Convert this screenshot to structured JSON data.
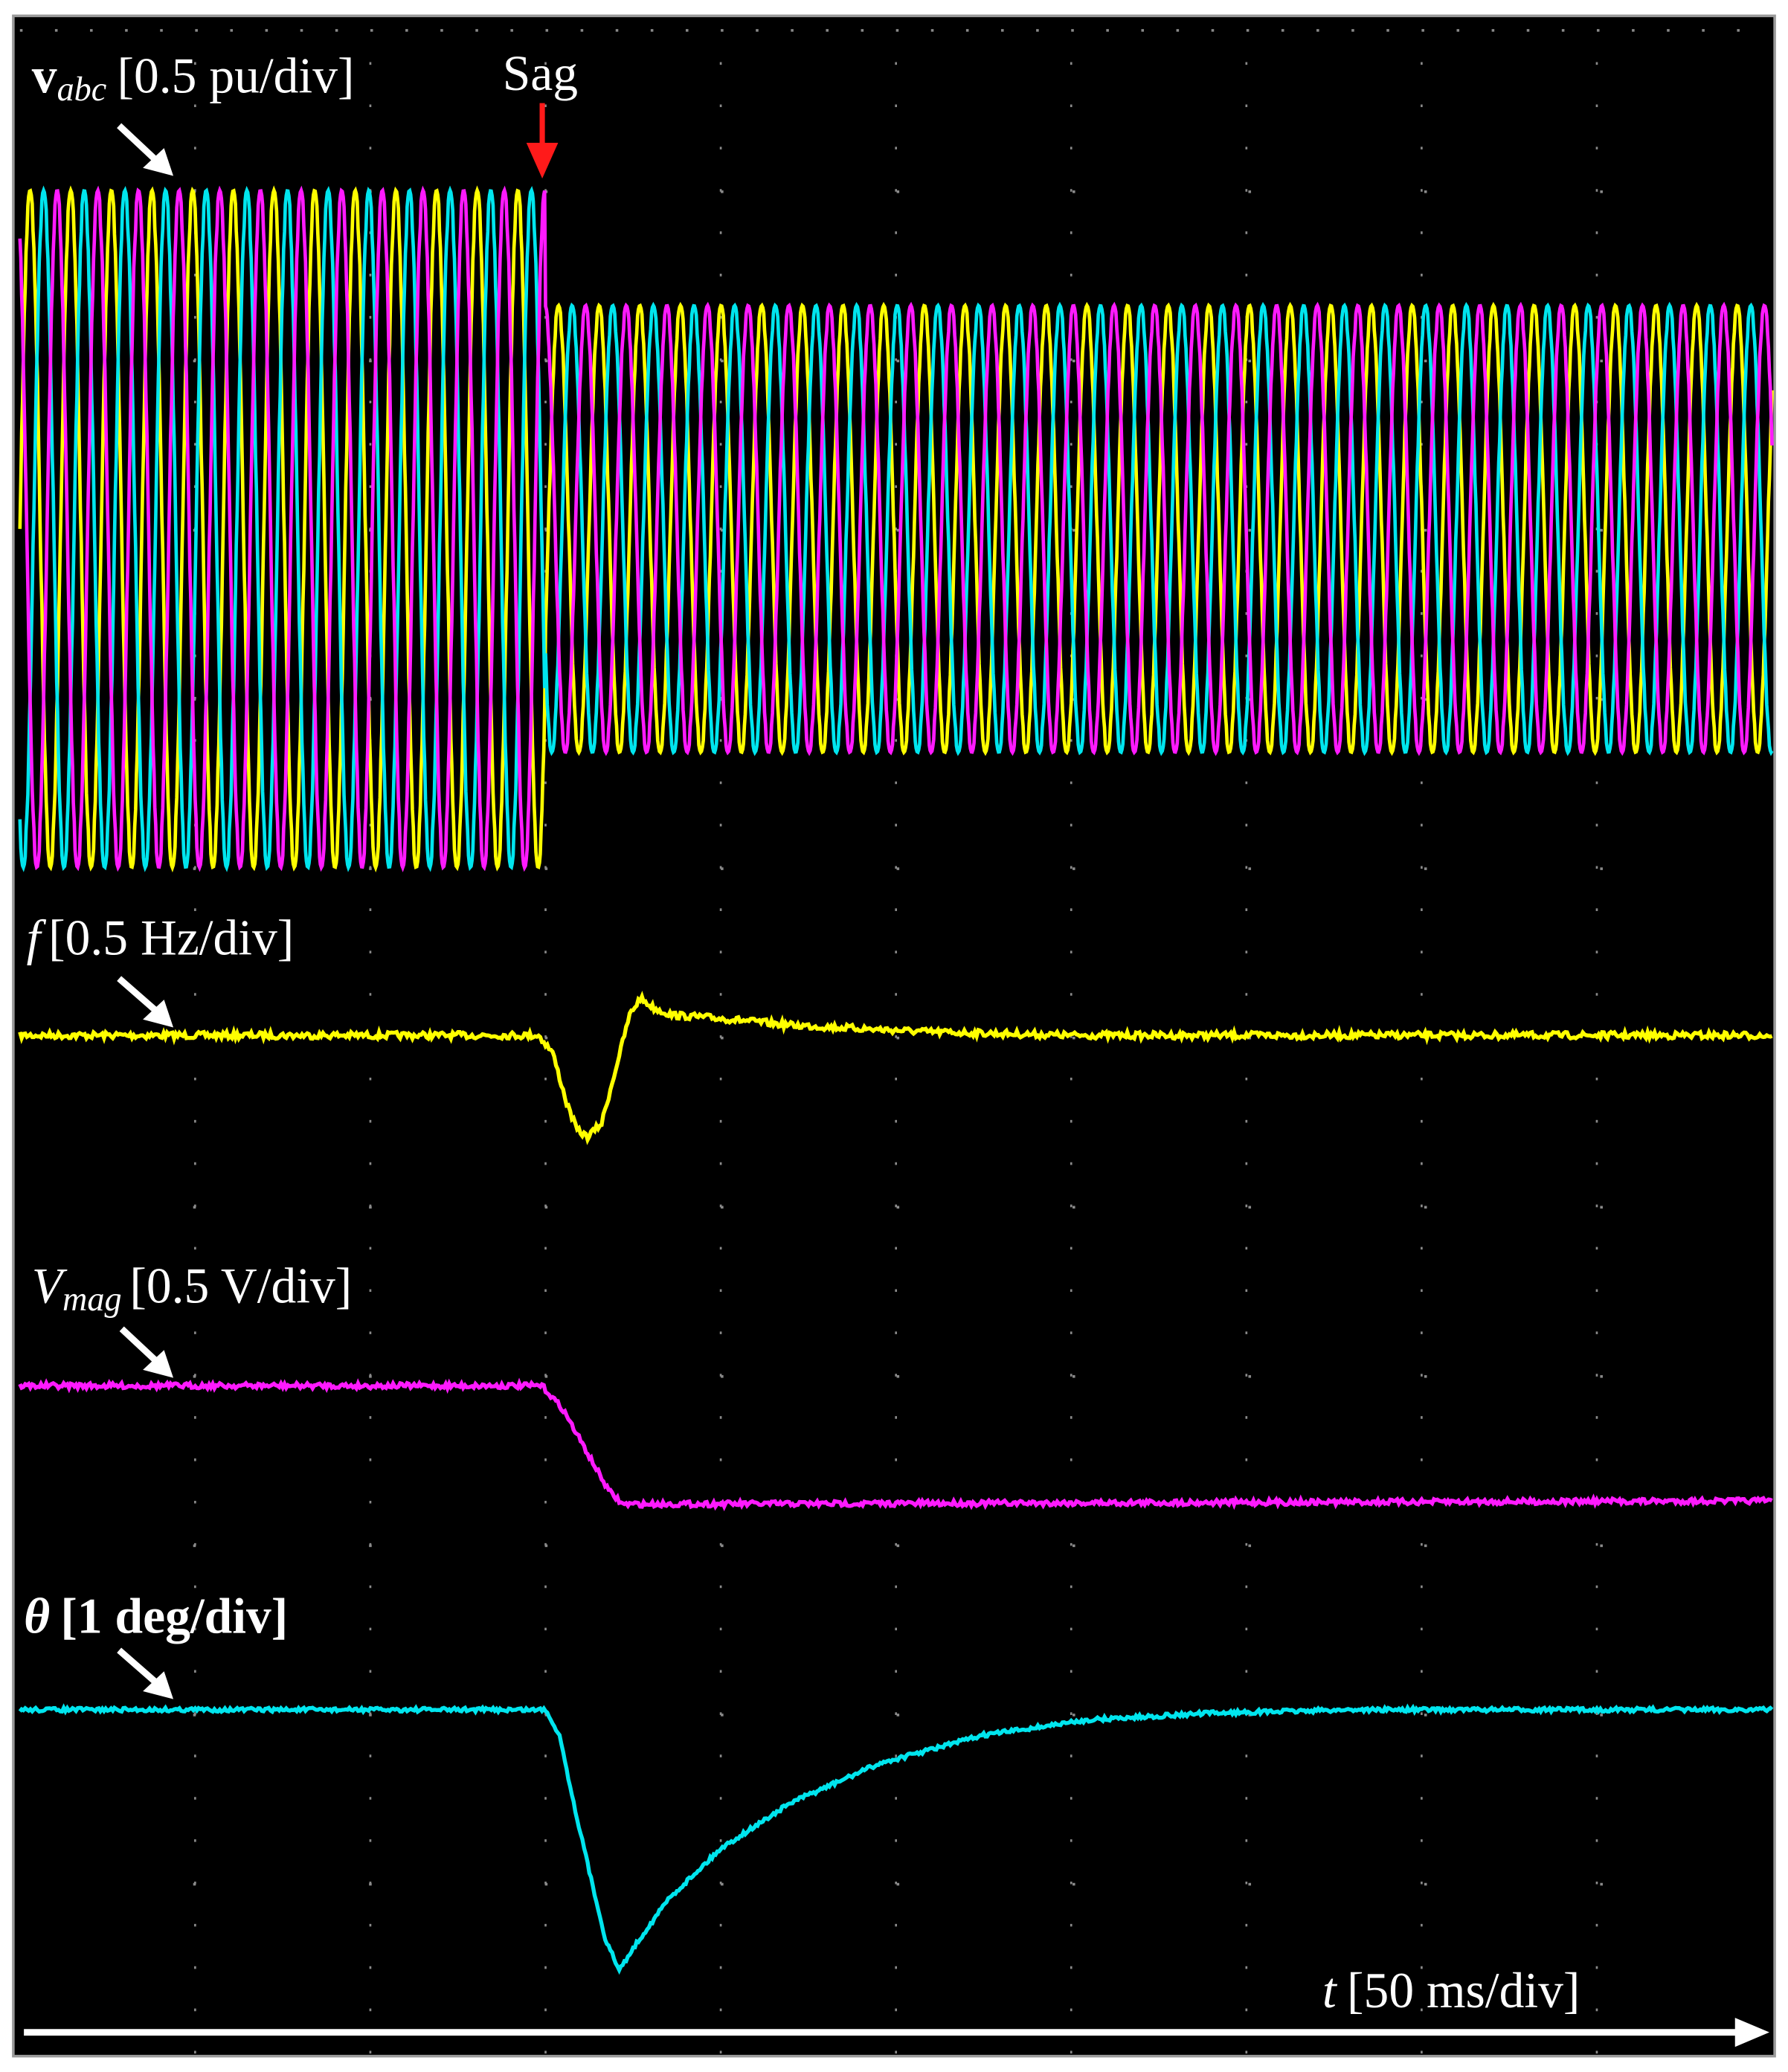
{
  "chart_data": {
    "type": "line",
    "title": "",
    "background": "#000000",
    "x_label": {
      "var": "t",
      "scale": "[50 ms/div]"
    },
    "x_range_ms": [
      0,
      500
    ],
    "x_divisions": 10,
    "y_divisions": 12,
    "grid": "dotted",
    "event": {
      "label": "Sag",
      "t_ms": 150,
      "color": "#ff1a1a"
    },
    "series": [
      {
        "name": "vabc",
        "label_main": "v",
        "label_sub": "abc",
        "scale": "[0.5 pu/div]",
        "unit": "pu",
        "units_per_div": 0.5,
        "phase_colors": [
          "#ffff00",
          "#00e5ee",
          "#ff1aff"
        ],
        "amplitude_pre_pu": 1.0,
        "amplitude_post_pu": 0.66,
        "period_ms": 11.6
      },
      {
        "name": "f",
        "label_main": "f",
        "scale": "[0.5 Hz/div]",
        "unit": "Hz (deviation)",
        "units_per_div": 0.5,
        "color": "#ffff00",
        "points": [
          [
            0,
            0
          ],
          [
            148,
            0
          ],
          [
            152,
            -0.05
          ],
          [
            156,
            -0.2
          ],
          [
            159,
            -0.28
          ],
          [
            162,
            -0.3
          ],
          [
            166,
            -0.26
          ],
          [
            170,
            -0.1
          ],
          [
            174,
            0.06
          ],
          [
            177,
            0.11
          ],
          [
            181,
            0.08
          ],
          [
            186,
            0.06
          ],
          [
            200,
            0.05
          ],
          [
            220,
            0.03
          ],
          [
            260,
            0.01
          ],
          [
            300,
            0
          ],
          [
            500,
            0
          ]
        ]
      },
      {
        "name": "Vmag",
        "label_main": "V",
        "label_sub": "mag",
        "scale": "[0.5 V/div]",
        "unit": "V (deviation)",
        "units_per_div": 0.5,
        "color": "#ff1aff",
        "points": [
          [
            0,
            0
          ],
          [
            149,
            0
          ],
          [
            155,
            -0.07
          ],
          [
            162,
            -0.2
          ],
          [
            168,
            -0.31
          ],
          [
            172,
            -0.35
          ],
          [
            500,
            -0.34
          ]
        ]
      },
      {
        "name": "theta",
        "label_main": "θ",
        "scale": "[1 deg/div]",
        "unit": "deg (deviation)",
        "units_per_div": 1,
        "color": "#00e5ee",
        "points": [
          [
            0,
            0
          ],
          [
            150,
            0
          ],
          [
            154,
            -0.15
          ],
          [
            158,
            -0.55
          ],
          [
            163,
            -1.0
          ],
          [
            167,
            -1.35
          ],
          [
            171,
            -1.54
          ],
          [
            176,
            -1.38
          ],
          [
            185,
            -1.12
          ],
          [
            200,
            -0.82
          ],
          [
            220,
            -0.55
          ],
          [
            245,
            -0.32
          ],
          [
            275,
            -0.15
          ],
          [
            305,
            -0.06
          ],
          [
            340,
            -0.02
          ],
          [
            380,
            0
          ],
          [
            500,
            0
          ]
        ]
      }
    ]
  }
}
